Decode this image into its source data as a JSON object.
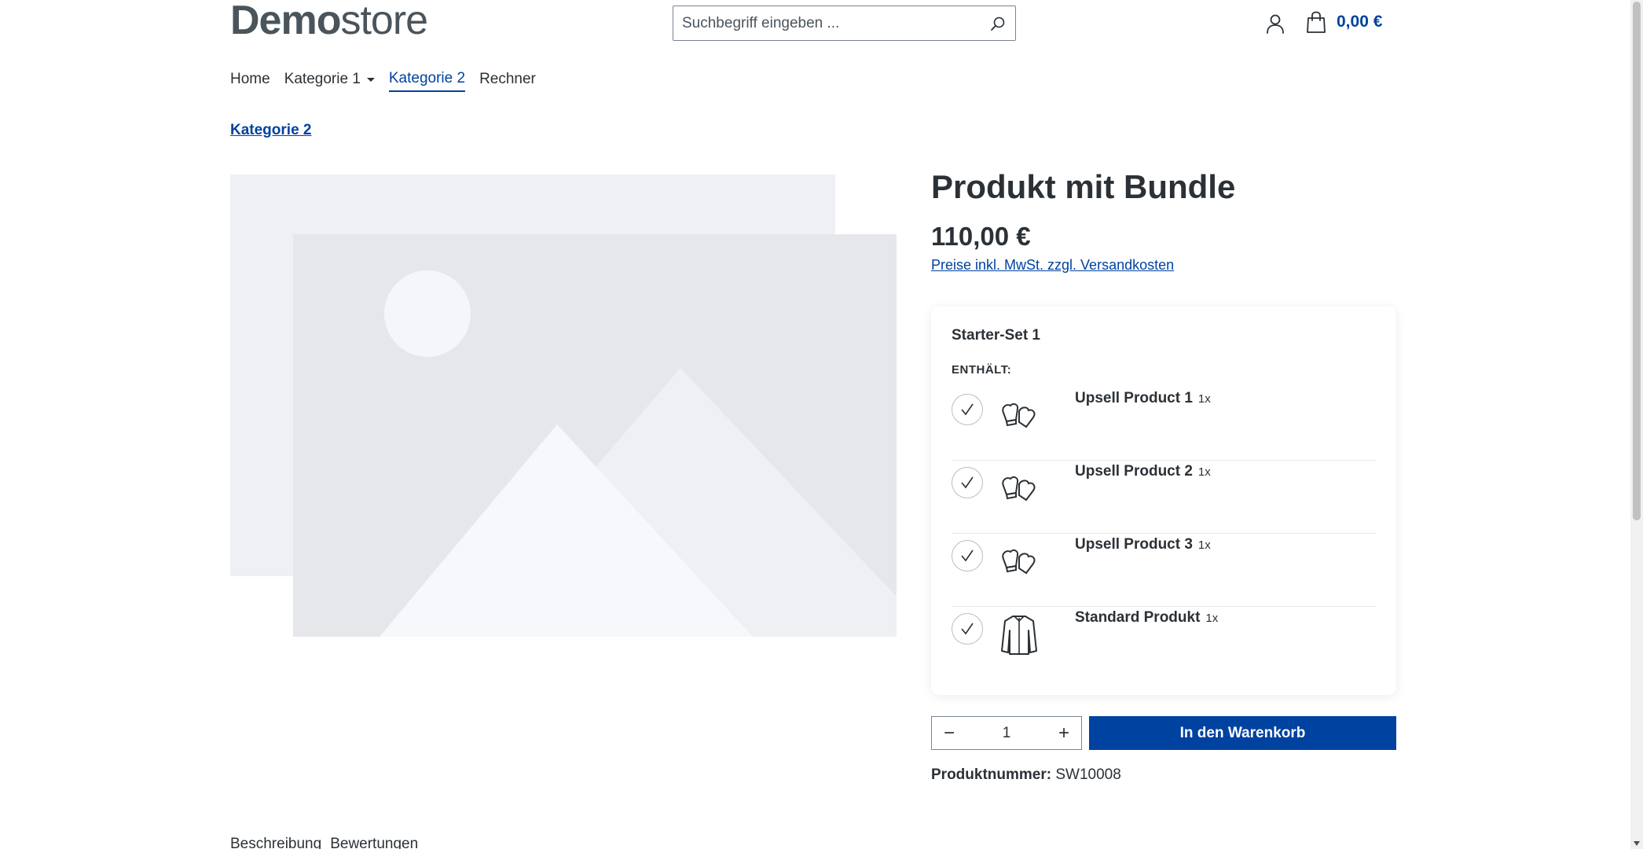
{
  "header": {
    "logo_bold": "Demo",
    "logo_light": "store",
    "search_placeholder": "Suchbegriff eingeben ...",
    "cart_total": "0,00 €"
  },
  "nav": {
    "items": [
      {
        "label": "Home"
      },
      {
        "label": "Kategorie 1"
      },
      {
        "label": "Kategorie 2"
      },
      {
        "label": "Rechner"
      }
    ]
  },
  "breadcrumb": "Kategorie 2",
  "product": {
    "title": "Produkt mit Bundle",
    "price": "110,00 €",
    "tax_note": "Preise inkl. MwSt. zzgl. Versandkosten",
    "number_label": "Produktnummer:",
    "number_value": "SW10008"
  },
  "bundle": {
    "name": "Starter-Set 1",
    "contains_label": "ENTHÄLT:",
    "items": [
      {
        "name": "Upsell Product 1",
        "qty": "1x",
        "icon": "mittens-icon"
      },
      {
        "name": "Upsell Product 2",
        "qty": "1x",
        "icon": "mittens-icon"
      },
      {
        "name": "Upsell Product 3",
        "qty": "1x",
        "icon": "mittens-icon"
      },
      {
        "name": "Standard Produkt",
        "qty": "1x",
        "icon": "jacket-icon"
      }
    ]
  },
  "buy": {
    "quantity": "1",
    "minus": "−",
    "plus": "+",
    "button_label": "In den Warenkorb"
  },
  "tabs": [
    {
      "label": "Beschreibung"
    },
    {
      "label": "Bewertungen"
    }
  ],
  "colors": {
    "accent": "#0042a0",
    "text": "#2b3136",
    "placeholder_bg": "#e9eaed"
  }
}
